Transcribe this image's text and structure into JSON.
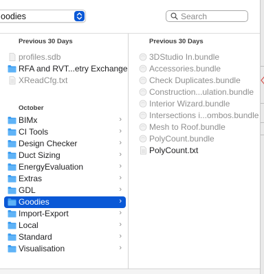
{
  "toolbar": {
    "location_popup": "oodies",
    "search_placeholder": "Search"
  },
  "column1": {
    "header_recent": "Previous 30 Days",
    "recent": [
      {
        "label": "profiles.sdb",
        "icon": "document-icon",
        "kind": "file",
        "dim": true
      },
      {
        "label": "RFA and RVT...etry Exchange",
        "icon": "folder-icon",
        "kind": "folder",
        "dim": false
      },
      {
        "label": "XReadCfg.txt",
        "icon": "text-file-icon",
        "kind": "file",
        "dim": true
      }
    ],
    "header_october": "October",
    "october": [
      {
        "label": "BIMx",
        "icon": "folder-icon"
      },
      {
        "label": "CI Tools",
        "icon": "folder-icon"
      },
      {
        "label": "Design Checker",
        "icon": "folder-icon"
      },
      {
        "label": "Duct Sizing",
        "icon": "folder-icon"
      },
      {
        "label": "EnergyEvaluation",
        "icon": "folder-icon"
      },
      {
        "label": "Extras",
        "icon": "folder-icon"
      },
      {
        "label": "GDL",
        "icon": "folder-icon"
      },
      {
        "label": "Goodies",
        "icon": "folder-icon",
        "selected": true
      },
      {
        "label": "Import-Export",
        "icon": "folder-icon"
      },
      {
        "label": "Local",
        "icon": "folder-icon"
      },
      {
        "label": "Standard",
        "icon": "folder-icon"
      },
      {
        "label": "Visualisation",
        "icon": "folder-icon"
      }
    ]
  },
  "column2": {
    "header_recent": "Previous 30 Days",
    "items": [
      {
        "label": "3DStudio In.bundle",
        "icon": "bundle-icon"
      },
      {
        "label": "Accessories.bundle",
        "icon": "bundle-icon"
      },
      {
        "label": "Check Duplicates.bundle",
        "icon": "bundle-icon"
      },
      {
        "label": "Construction...ulation.bundle",
        "icon": "bundle-icon"
      },
      {
        "label": "Interior Wizard.bundle",
        "icon": "bundle-icon"
      },
      {
        "label": "Intersections i...ombos.bundle",
        "icon": "bundle-icon"
      },
      {
        "label": "Mesh to Roof.bundle",
        "icon": "bundle-icon"
      },
      {
        "label": "PolyCount.bundle",
        "icon": "bundle-icon"
      },
      {
        "label": "PolyCount.txt",
        "icon": "text-file-icon",
        "enabled": true
      }
    ]
  },
  "colors": {
    "selection": "#0a58d6",
    "folder": "#3b9cf0",
    "dim_text": "#8e8e8e"
  }
}
